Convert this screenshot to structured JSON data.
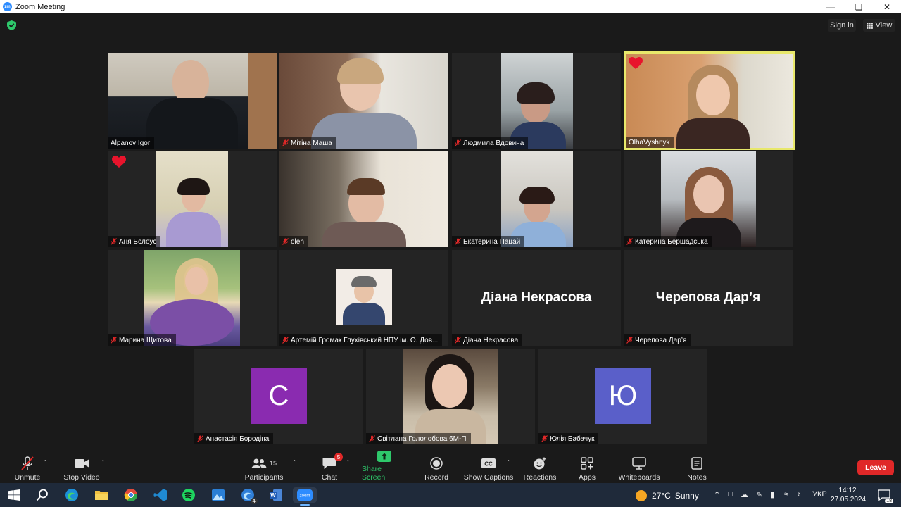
{
  "window": {
    "title": "Zoom Meeting",
    "app_icon_text": "zm"
  },
  "topbar": {
    "signin": "Sign in",
    "view": "View"
  },
  "tiles": [
    {
      "name": "Alpanov Igor",
      "muted": false
    },
    {
      "name": "Мітіна Маша",
      "muted": true
    },
    {
      "name": "Людмила Вдовина",
      "muted": true
    },
    {
      "name": "OlhaVyshnyk",
      "muted": false,
      "active": true,
      "heart": true
    },
    {
      "name": "Аня Бєлоус",
      "muted": true,
      "heart": true
    },
    {
      "name": "oleh",
      "muted": true
    },
    {
      "name": "Екатерина Пацай",
      "muted": true
    },
    {
      "name": "Катерина Бершадська",
      "muted": true
    },
    {
      "name": "Марина Щитова",
      "muted": true
    },
    {
      "name": "Артемій Громак Глухівський НПУ ім. О. Дов...",
      "muted": true
    },
    {
      "name": "Діана Некрасова",
      "muted": true,
      "display_name": "Діана Некрасова"
    },
    {
      "name": "Черепова Дар’я",
      "muted": true,
      "display_name": "Черепова Дар’я"
    },
    {
      "name": "Анастасія Бородіна",
      "muted": true,
      "avatar_letter": "С",
      "avatar_color": "#8a2bb0"
    },
    {
      "name": "Світлана Гололобова 6М-П",
      "muted": true
    },
    {
      "name": "Юлія Бабачук",
      "muted": true,
      "avatar_letter": "Ю",
      "avatar_color": "#5a5fc9"
    }
  ],
  "toolbar": {
    "unmute": "Unmute",
    "stop_video": "Stop Video",
    "participants": "Participants",
    "participants_count": "15",
    "chat": "Chat",
    "chat_badge": "5",
    "share_screen": "Share Screen",
    "record": "Record",
    "show_captions": "Show Captions",
    "captions_icon_text": "CC",
    "reactions": "Reactions",
    "apps": "Apps",
    "whiteboards": "Whiteboards",
    "notes": "Notes",
    "leave": "Leave"
  },
  "taskbar": {
    "weather_temp": "27°C",
    "weather_desc": "Sunny",
    "language": "УКР",
    "time": "14:12",
    "date": "27.05.2024",
    "notification_count": "18",
    "edge_badge": "4"
  },
  "colors": {
    "accent": "#2d8cff",
    "share_green": "#2ec86b",
    "leave_red": "#e02828",
    "active_speaker": "#e8e86b"
  }
}
